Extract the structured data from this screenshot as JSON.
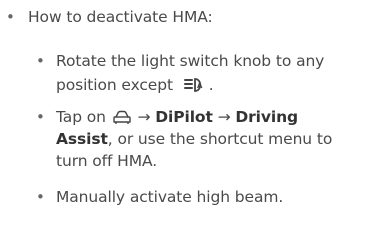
{
  "intro": "How to deactivate HMA:",
  "items": [
    {
      "line1": "Rotate the light switch knob to any",
      "line2_prefix": "position except",
      "line2_icon": "auto-high-beam-icon",
      "line2_suffix": "."
    },
    {
      "prefix": "Tap on",
      "icon": "car-icon",
      "arrow": "→",
      "menu1": "DiPilot",
      "menu2": "Driving",
      "menu2_cont": "Assist",
      "line2_suffix": ", or use the shortcut menu to",
      "line3": "turn off HMA."
    },
    {
      "text": "Manually activate high beam."
    }
  ]
}
